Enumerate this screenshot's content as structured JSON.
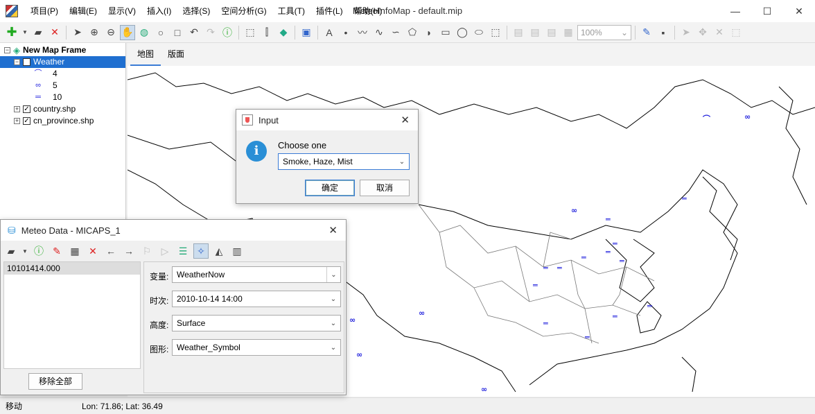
{
  "window": {
    "title": "MeteoInfoMap - default.mip",
    "minimize": "—",
    "maximize": "☐",
    "close": "✕"
  },
  "menu": [
    "项目(P)",
    "编辑(E)",
    "显示(V)",
    "插入(I)",
    "选择(S)",
    "空间分析(G)",
    "工具(T)",
    "插件(L)",
    "帮助(H)"
  ],
  "toolbar": {
    "zoom": "100%"
  },
  "tree": {
    "root": "New Map Frame",
    "layers": [
      {
        "name": "Weather",
        "legend": [
          {
            "symbol": "⌒",
            "label": "4"
          },
          {
            "symbol": "∞",
            "label": "5"
          },
          {
            "symbol": "═",
            "label": "10"
          }
        ]
      },
      {
        "name": "country.shp"
      },
      {
        "name": "cn_province.shp"
      }
    ]
  },
  "map_tabs": [
    "地图",
    "版面"
  ],
  "status": {
    "mode": "移动",
    "coords": "Lon: 71.86; Lat: 36.49"
  },
  "input_dialog": {
    "title": "Input",
    "prompt": "Choose one",
    "selected": "Smoke, Haze, Mist",
    "ok": "确定",
    "cancel": "取消"
  },
  "meteo_dialog": {
    "title": "Meteo Data - MICAPS_1",
    "files": [
      "10101414.000"
    ],
    "remove_all": "移除全部",
    "fields": [
      {
        "label": "变量:",
        "value": "WeatherNow"
      },
      {
        "label": "时次:",
        "value": "2010-10-14 14:00"
      },
      {
        "label": "高度:",
        "value": "Surface"
      },
      {
        "label": "图形:",
        "value": "Weather_Symbol"
      }
    ]
  },
  "colors": {
    "selection": "#1f6fd0",
    "symbol": "#2222dd",
    "info": "#2a8fd6"
  }
}
